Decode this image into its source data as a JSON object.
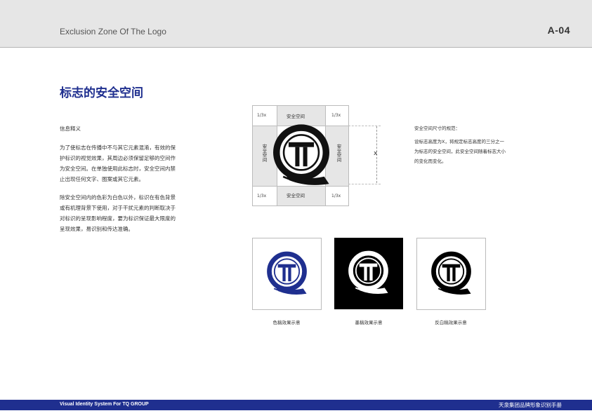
{
  "header": {
    "title": "Exclusion Zone Of The Logo",
    "page_number": "A-04"
  },
  "section": {
    "title": "标志的安全空间",
    "subheading": "信息释义",
    "paragraph_1": "为了使标志在传播中不与其它元素混淆，有效的保护标识的视觉效果，其周边必须保留足够的空间作为安全空间。在单独使用此标志时，安全空间内禁止出现任何文字、图案或其它元素。",
    "paragraph_2": "除安全空间内的色彩为白色以外，标识在有色背景或有机理背景下使用，对于干扰元素的判断取决于对标识的呈现影响程度，要为标识保证最大限度的呈现效果，易识别和传达准确。"
  },
  "diagram": {
    "corner_top_left": "1/3x",
    "corner_top_right": "1/3x",
    "corner_bottom_left": "1/3x",
    "corner_bottom_right": "1/3x",
    "zone_top": "安全空间",
    "zone_bottom": "安全空间",
    "zone_left": "安全空间",
    "zone_right": "安全空间",
    "dimension_label": "x"
  },
  "notes": {
    "title": "安全空间尺寸的规范：",
    "body": "设标志高度为X，将规定标志高度的三分之一为标志的安全空间，此安全空间随着标志大小的变化而变化。"
  },
  "samples": [
    {
      "caption": "色稿效果示意"
    },
    {
      "caption": "墨稿效果示意"
    },
    {
      "caption": "反白稿效果示意"
    }
  ],
  "footer": {
    "left": "Visual Identity System For TQ GROUP",
    "right": "天泉集团品牌形象识别手册"
  },
  "colors": {
    "brand_blue": "#1f2f8f",
    "header_gray": "#e6e6e6",
    "zone_gray": "#e6e6e6"
  },
  "icons": {
    "logo": "tq-logo-icon"
  }
}
